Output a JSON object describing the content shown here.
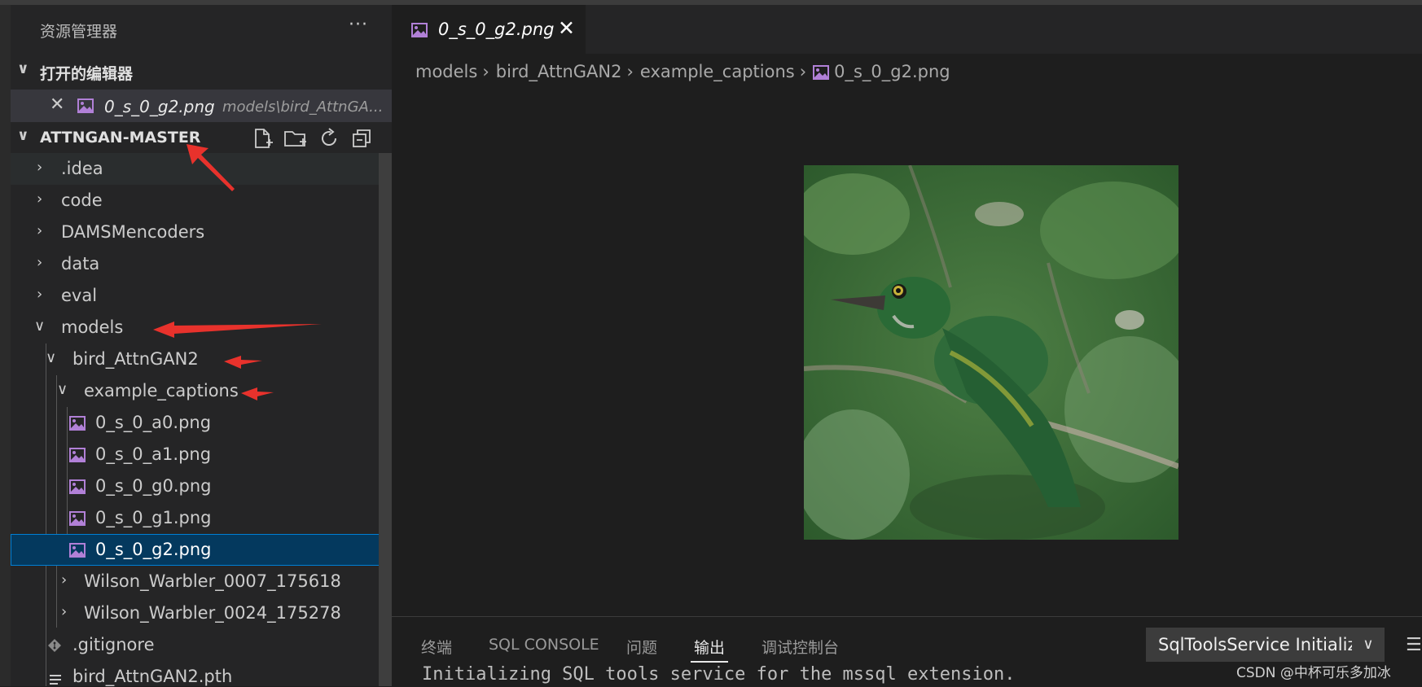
{
  "sidebar": {
    "title": "资源管理器",
    "more": "···",
    "open_editors": {
      "label": "打开的编辑器",
      "file": "0_s_0_g2.png",
      "path": "models\\bird_AttnGA..."
    },
    "project": {
      "label": "ATTNGAN-MASTER"
    },
    "tree": [
      {
        "label": ".idea"
      },
      {
        "label": "code"
      },
      {
        "label": "DAMSMencoders"
      },
      {
        "label": "data"
      },
      {
        "label": "eval"
      },
      {
        "label": "models"
      },
      {
        "label": "bird_AttnGAN2"
      },
      {
        "label": "example_captions"
      },
      {
        "label": "0_s_0_a0.png"
      },
      {
        "label": "0_s_0_a1.png"
      },
      {
        "label": "0_s_0_g0.png"
      },
      {
        "label": "0_s_0_g1.png"
      },
      {
        "label": "0_s_0_g2.png"
      },
      {
        "label": "Wilson_Warbler_0007_175618"
      },
      {
        "label": "Wilson_Warbler_0024_175278"
      },
      {
        "label": ".gitignore"
      },
      {
        "label": "bird_AttnGAN2.pth"
      }
    ]
  },
  "editor": {
    "tab": {
      "label": "0_s_0_g2.png",
      "close": "✕"
    },
    "breadcrumb": [
      "models",
      "bird_AttnGAN2",
      "example_captions",
      "0_s_0_g2.png"
    ],
    "breadcrumb_sep": "›"
  },
  "panel": {
    "tabs": [
      "终端",
      "SQL CONSOLE",
      "问题",
      "输出",
      "调试控制台"
    ],
    "active_tab": "输出",
    "channel": "SqlToolsService Initializ",
    "output_line": "Initializing SQL tools service for the mssql extension."
  },
  "watermark": "CSDN @中杯可乐多加冰",
  "colors": {
    "selection": "#04395e",
    "selection_border": "#007fd4",
    "image_icon": "#b180d7",
    "arrow": "#e8322c"
  }
}
